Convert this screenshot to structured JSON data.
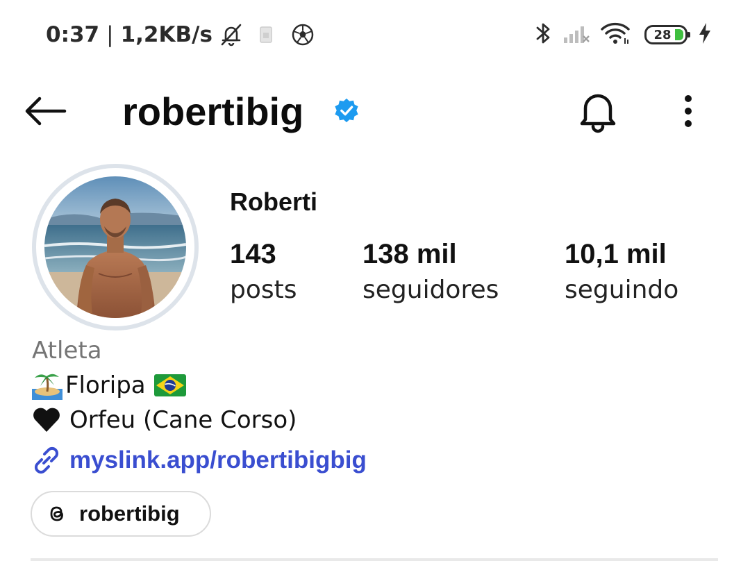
{
  "status_bar": {
    "time": "0:37",
    "separator": "|",
    "speed": "1,2KB/s",
    "battery_level": "28",
    "icons": [
      "bell-off-icon",
      "sim-icon",
      "soccer-ball-icon",
      "bluetooth-icon",
      "signal-icon",
      "wifi-icon",
      "battery-icon",
      "charging-icon"
    ],
    "battery_color": "#3fbf3f"
  },
  "header": {
    "username": "robertibig",
    "verified": true,
    "verified_color": "#1d9bf0",
    "icons": [
      "back-arrow-icon",
      "bell-icon",
      "more-vertical-icon"
    ]
  },
  "profile": {
    "display_name": "Roberti",
    "stats": [
      {
        "value": "143",
        "label": "posts"
      },
      {
        "value": "138 mil",
        "label": "seguidores"
      },
      {
        "value": "10,1 mil",
        "label": "seguindo"
      }
    ]
  },
  "bio": {
    "category": "Atleta",
    "line1": "Floripa",
    "line2": "Orfeu (Cane Corso)",
    "link": "myslink.app/robertibigbig",
    "link_color": "#3a4ed0"
  },
  "threads_chip": {
    "label": "robertibig"
  }
}
